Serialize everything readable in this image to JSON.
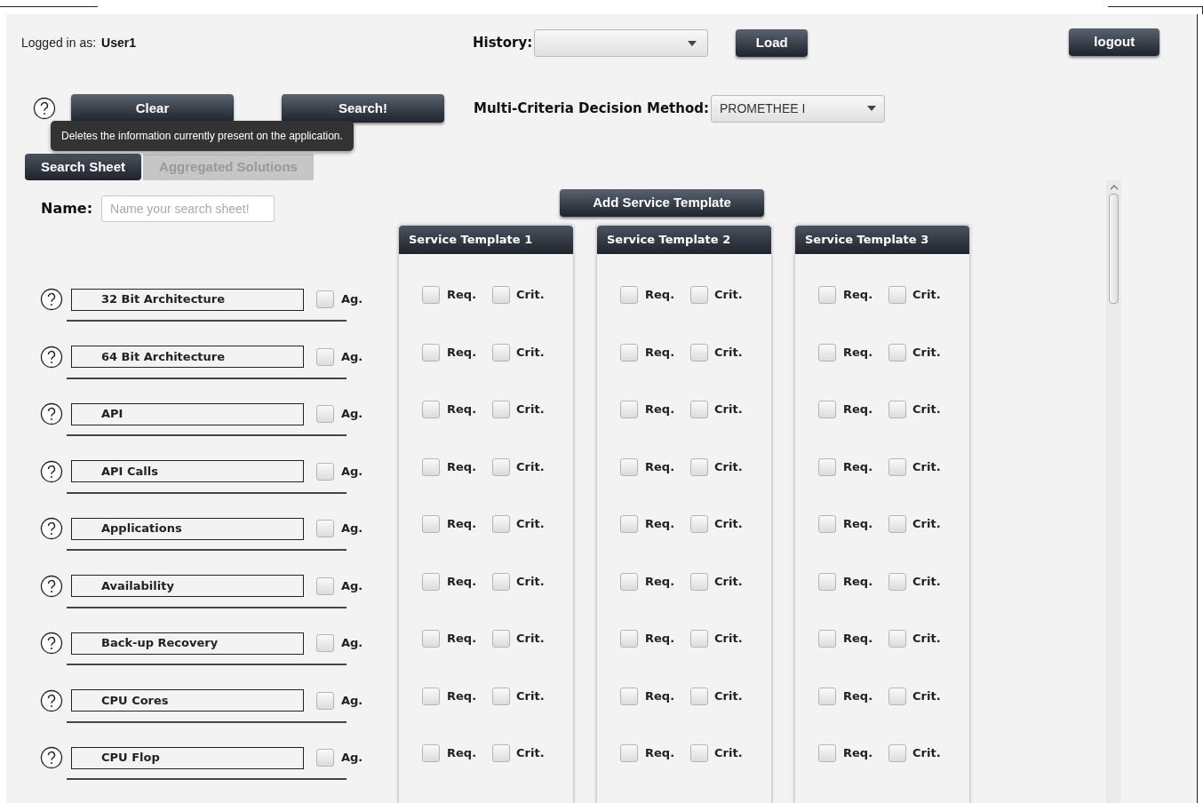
{
  "header": {
    "logged_in_label": "Logged in as:",
    "user": "User1",
    "history_label": "History:",
    "load_button": "Load",
    "logout_button": "logout"
  },
  "toolbar": {
    "clear_button": "Clear",
    "search_button": "Search!",
    "method_label": "Multi-Criteria Decision Method:",
    "method_value": "PROMETHEE I"
  },
  "tooltip": "Deletes the information currently present on the application.",
  "tabs": [
    {
      "label": "Search Sheet",
      "selected": true
    },
    {
      "label": "Aggregated Solutions",
      "selected": false
    }
  ],
  "name_field": {
    "label": "Name:",
    "placeholder": "Name your search sheet!"
  },
  "add_template_button": "Add Service Template",
  "criteria": [
    {
      "label": "32 Bit Architecture",
      "ag_label": "Ag.",
      "ag": false
    },
    {
      "label": "64 Bit Architecture",
      "ag_label": "Ag.",
      "ag": false
    },
    {
      "label": "API",
      "ag_label": "Ag.",
      "ag": false
    },
    {
      "label": "API Calls",
      "ag_label": "Ag.",
      "ag": false
    },
    {
      "label": "Applications",
      "ag_label": "Ag.",
      "ag": false
    },
    {
      "label": "Availability",
      "ag_label": "Ag.",
      "ag": false
    },
    {
      "label": "Back-up Recovery",
      "ag_label": "Ag.",
      "ag": false
    },
    {
      "label": "CPU Cores",
      "ag_label": "Ag.",
      "ag": false
    },
    {
      "label": "CPU Flop",
      "ag_label": "Ag.",
      "ag": false
    }
  ],
  "templates": [
    {
      "title": "Service Template 1",
      "rows": [
        {
          "req_label": "Req.",
          "req": false,
          "crit_label": "Crit.",
          "crit": false
        },
        {
          "req_label": "Req.",
          "req": false,
          "crit_label": "Crit.",
          "crit": false
        },
        {
          "req_label": "Req.",
          "req": false,
          "crit_label": "Crit.",
          "crit": false
        },
        {
          "req_label": "Req.",
          "req": false,
          "crit_label": "Crit.",
          "crit": false
        },
        {
          "req_label": "Req.",
          "req": false,
          "crit_label": "Crit.",
          "crit": false
        },
        {
          "req_label": "Req.",
          "req": false,
          "crit_label": "Crit.",
          "crit": false
        },
        {
          "req_label": "Req.",
          "req": false,
          "crit_label": "Crit.",
          "crit": false
        },
        {
          "req_label": "Req.",
          "req": false,
          "crit_label": "Crit.",
          "crit": false
        },
        {
          "req_label": "Req.",
          "req": false,
          "crit_label": "Crit.",
          "crit": false
        }
      ]
    },
    {
      "title": "Service Template 2",
      "rows": [
        {
          "req_label": "Req.",
          "req": false,
          "crit_label": "Crit.",
          "crit": false
        },
        {
          "req_label": "Req.",
          "req": false,
          "crit_label": "Crit.",
          "crit": false
        },
        {
          "req_label": "Req.",
          "req": false,
          "crit_label": "Crit.",
          "crit": false
        },
        {
          "req_label": "Req.",
          "req": false,
          "crit_label": "Crit.",
          "crit": false
        },
        {
          "req_label": "Req.",
          "req": false,
          "crit_label": "Crit.",
          "crit": false
        },
        {
          "req_label": "Req.",
          "req": false,
          "crit_label": "Crit.",
          "crit": false
        },
        {
          "req_label": "Req.",
          "req": false,
          "crit_label": "Crit.",
          "crit": false
        },
        {
          "req_label": "Req.",
          "req": false,
          "crit_label": "Crit.",
          "crit": false
        },
        {
          "req_label": "Req.",
          "req": false,
          "crit_label": "Crit.",
          "crit": false
        }
      ]
    },
    {
      "title": "Service Template 3",
      "rows": [
        {
          "req_label": "Req.",
          "req": false,
          "crit_label": "Crit.",
          "crit": false
        },
        {
          "req_label": "Req.",
          "req": false,
          "crit_label": "Crit.",
          "crit": false
        },
        {
          "req_label": "Req.",
          "req": false,
          "crit_label": "Crit.",
          "crit": false
        },
        {
          "req_label": "Req.",
          "req": false,
          "crit_label": "Crit.",
          "crit": false
        },
        {
          "req_label": "Req.",
          "req": false,
          "crit_label": "Crit.",
          "crit": false
        },
        {
          "req_label": "Req.",
          "req": false,
          "crit_label": "Crit.",
          "crit": false
        },
        {
          "req_label": "Req.",
          "req": false,
          "crit_label": "Crit.",
          "crit": false
        },
        {
          "req_label": "Req.",
          "req": false,
          "crit_label": "Crit.",
          "crit": false
        },
        {
          "req_label": "Req.",
          "req": false,
          "crit_label": "Crit.",
          "crit": false
        }
      ]
    }
  ]
}
